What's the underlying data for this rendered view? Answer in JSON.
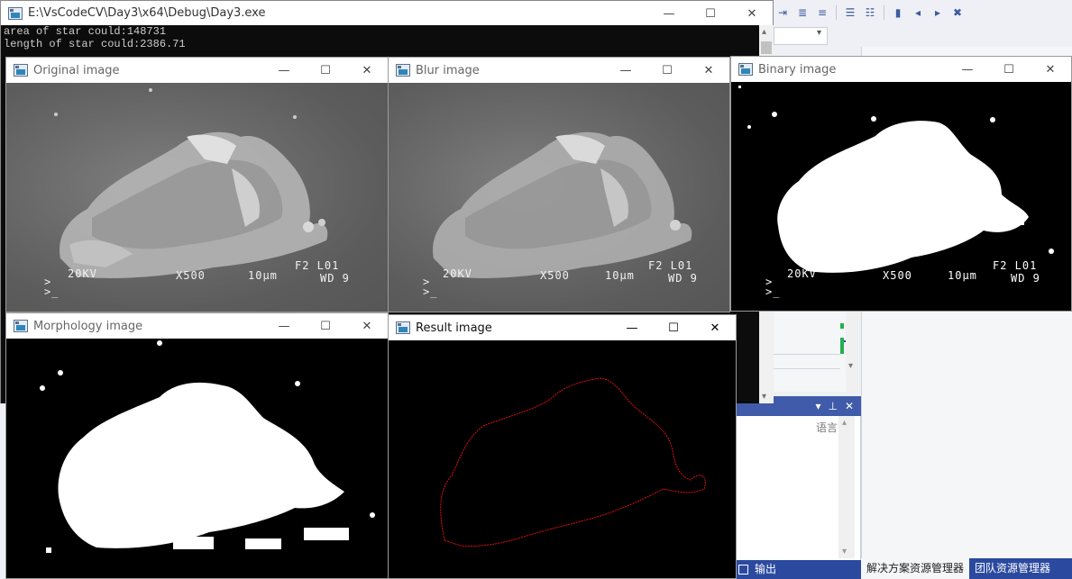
{
  "console": {
    "title": "E:\\VsCodeCV\\Day3\\x64\\Debug\\Day3.exe",
    "lines": [
      "area of star could:148731",
      "length of star could:2386.71"
    ]
  },
  "windows": {
    "original": {
      "title": "Original image"
    },
    "blur": {
      "title": "Blur image"
    },
    "binary": {
      "title": "Binary image"
    },
    "morphology": {
      "title": "Morphology image"
    },
    "result": {
      "title": "Result image"
    }
  },
  "controls": {
    "minimize": "—",
    "maximize": "☐",
    "close": "✕"
  },
  "sem_caption": {
    "voltage": "20KV",
    "mag": "X500",
    "scale": "10μm",
    "code": "F2 L01",
    "wd": "WD 9",
    "prompt": "> \n>_"
  },
  "ide": {
    "language_label": "语言",
    "output_tab": "输出",
    "bottom_tabs": [
      "解决方案资源管理器",
      "团队资源管理器"
    ]
  },
  "colors": {
    "contour": "#e01010",
    "console_bg": "#0c0c0c",
    "ide_accent": "#2b4a9f"
  }
}
